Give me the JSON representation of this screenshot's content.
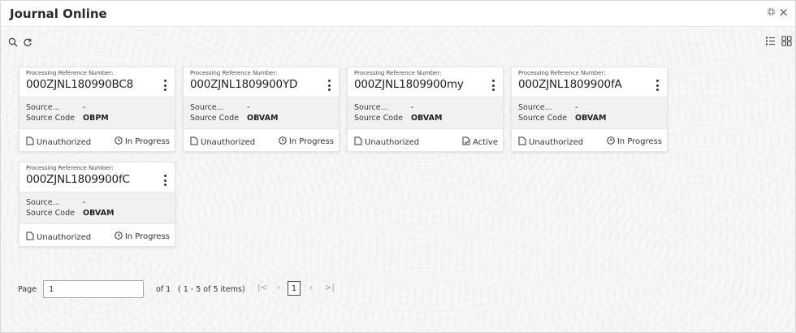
{
  "window": {
    "title": "Journal Online",
    "controls": {
      "minimize_icon": "shrink-icon",
      "close_icon": "close-icon",
      "close_glyph": "×"
    }
  },
  "toolbar": {
    "search_icon": "search-icon",
    "refresh_icon": "refresh-icon",
    "list_view_icon": "list-view-icon",
    "grid_view_icon": "grid-view-icon"
  },
  "cards": [
    {
      "ref_label": "Processing Reference Number:",
      "ref_number": "000ZJNL180990BC8",
      "source_label": "Source...",
      "source_value": "-",
      "source_code_label": "Source Code",
      "source_code_value": "OBPM",
      "auth_status": "Unauthorized",
      "process_status": "In Progress",
      "process_icon": "clock-icon"
    },
    {
      "ref_label": "Processing Reference Number:",
      "ref_number": "000ZJNL1809900YD",
      "source_label": "Source...",
      "source_value": "-",
      "source_code_label": "Source Code",
      "source_code_value": "OBVAM",
      "auth_status": "Unauthorized",
      "process_status": "In Progress",
      "process_icon": "clock-icon"
    },
    {
      "ref_label": "Processing Reference Number:",
      "ref_number": "000ZJNL1809900my",
      "source_label": "Source...",
      "source_value": "-",
      "source_code_label": "Source Code",
      "source_code_value": "OBVAM",
      "auth_status": "Unauthorized",
      "process_status": "Active",
      "process_icon": "active-doc-icon"
    },
    {
      "ref_label": "Processing Reference Number:",
      "ref_number": "000ZJNL1809900fA",
      "source_label": "Source...",
      "source_value": "-",
      "source_code_label": "Source Code",
      "source_code_value": "OBVAM",
      "auth_status": "Unauthorized",
      "process_status": "In Progress",
      "process_icon": "clock-icon"
    },
    {
      "ref_label": "Processing Reference Number:",
      "ref_number": "000ZJNL1809900fC",
      "source_label": "Source...",
      "source_value": "-",
      "source_code_label": "Source Code",
      "source_code_value": "OBVAM",
      "auth_status": "Unauthorized",
      "process_status": "In Progress",
      "process_icon": "clock-icon"
    }
  ],
  "pagination": {
    "page_label": "Page",
    "page_value": "1",
    "of_label": "of 1",
    "items_label": "( 1 - 5 of 5 items)",
    "first_glyph": "|<",
    "prev_glyph": "‹",
    "current_page": "1",
    "next_glyph": "›",
    "last_glyph": ">|"
  },
  "colors": {
    "background": "#f7f7f7",
    "card": "#ffffff",
    "card_mid": "#f1f1f1",
    "text": "#2b2b2b"
  }
}
